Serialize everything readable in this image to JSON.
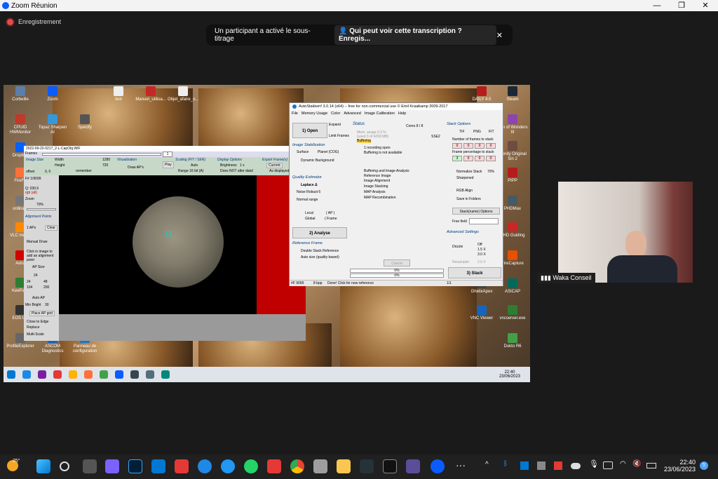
{
  "zoom": {
    "window_title": "Zoom Réunion",
    "recording_label": "Enregistrement",
    "caption_notice": "Un participant a activé le sous-titrage",
    "caption_question": "Qui peut voir cette transcription ? Enregis...",
    "participant_name": "Waka Conseil"
  },
  "colors": {
    "zoom_blue": "#0b5cff",
    "record_red": "#e54b4b",
    "as_red_canvas": "#c00000"
  },
  "desktop": {
    "icons_left": [
      {
        "label": "Corbeille",
        "color": "#5d7ea8"
      },
      {
        "label": "Zoom",
        "color": "#0b5cff"
      },
      {
        "label": "CPUID HWMonitor",
        "color": "#c0392b"
      },
      {
        "label": "Topaz Sharpen AI",
        "color": "#3498db"
      },
      {
        "label": "Specify",
        "color": "#555"
      },
      {
        "label": "Dropbox",
        "color": "#0061fe"
      },
      {
        "label": "FireFo",
        "color": "#ff7139"
      },
      {
        "label": "ordinate",
        "color": "#777"
      },
      {
        "label": "VLC media",
        "color": "#ff8800"
      },
      {
        "label": "Avira",
        "color": "#d20000"
      },
      {
        "label": "KeePass",
        "color": "#2e7d32"
      },
      {
        "label": "EOS Util",
        "color": "#333"
      },
      {
        "label": "ProfileExplorer",
        "color": "#666"
      },
      {
        "label": "ASCOM Diagnostics",
        "color": "#1565c0"
      },
      {
        "label": "Panneau de configuration",
        "color": "#1976d2"
      }
    ],
    "icons_top": [
      {
        "label": "test"
      },
      {
        "label": "Manuel_utilisa..."
      },
      {
        "label": "Objet_afaire_o..."
      },
      {
        "label": "DAILY 4.0"
      },
      {
        "label": "Steam"
      }
    ],
    "icons_right": [
      {
        "label": "Age of Wonders III",
        "color": "#8e44ad"
      },
      {
        "label": "Infinity Original Sin 2",
        "color": "#6d4c41"
      },
      {
        "label": "PIPP",
        "color": "#b71c1c"
      },
      {
        "label": "PHDMax",
        "color": "#455a64"
      },
      {
        "label": "PHD Guiding",
        "color": "#c62828"
      },
      {
        "label": "FireCapture",
        "color": "#e65100"
      },
      {
        "label": "GhelixApex",
        "color": "#424242"
      },
      {
        "label": "ASICAP",
        "color": "#00695c"
      },
      {
        "label": "VNC Viewer",
        "color": "#1565c0"
      },
      {
        "label": "vncserver.exe",
        "color": "#2e7d32"
      },
      {
        "label": "Dukto R6",
        "color": "#43a047"
      }
    ]
  },
  "autostakkert": {
    "title": "AutoStakkert! 3.0.14 (x64) -- free for non-commercial use © Emil Kraaikamp 2009-2017",
    "menu": [
      "File",
      "Memory Usage",
      "Color",
      "Advanced",
      "Image Calibration",
      "Help"
    ],
    "open_button": "1) Open",
    "expand": "Expand",
    "limit_frames": "Limit Frames",
    "status_heading": "Status",
    "cores": "Cores 8 / 8",
    "sse": "SSE2",
    "mem": "Mem. usage 0.3 %",
    "mem2": "(used 3 of 4299 MB)",
    "buffering": "Buffering",
    "status_lines": [
      "1 recording open",
      "Buffering is not available"
    ],
    "analysis_lines": [
      "Buffering and Image Analysis",
      "Reference Image",
      "Image Alignment",
      "Image Stacking",
      "MAP Analysis",
      "MAP Recombination"
    ],
    "image_stab_heading": "Image Stabilization",
    "surface": "Surface",
    "planet": "Planet (COG)",
    "dynamic_bg": "Dynamic Background",
    "quality_heading": "Quality Estimator",
    "laplace": "Laplace Δ",
    "noise_robust": "Noise Robust 6",
    "normal_range": "Normal range",
    "local": "Local",
    "local_ap": "( AP )",
    "global": "Global",
    "global_frame": "( Frame",
    "analyse_button": "2) Analyse",
    "ref_heading": "Reference Frame",
    "double_stack": "Double Stack Reference",
    "auto_size": "Auto size (quality based)",
    "cancel": "Cancel",
    "progress1": "0%",
    "progress2": "0%",
    "progress_value": 0,
    "statusbar_frames": "#F 9099",
    "statusbar_bpp": "8 bpp",
    "statusbar_msg": "Done! Click for new reference",
    "statusbar_page": "1/1",
    "stack_heading": "Stack Options",
    "fmt_tif": "TIF",
    "fmt_png": "PNG",
    "fmt_fit": "FIT",
    "num_frames": "Number of frames to stack",
    "frame_pct": "Frame percentage to stack",
    "num_inputs": [
      "0",
      "0",
      "0",
      "0"
    ],
    "pct_inputs": [
      "3",
      "0",
      "0",
      "0"
    ],
    "normalize": "Normalize Stack",
    "normalize_val": "70%",
    "sharpened": "Sharpened",
    "rgb_align": "RGB Align",
    "save_folders": "Save in Folders",
    "stackname_button": "Stack(name) Options",
    "free_field": "Free field",
    "advanced_heading": "Advanced Settings",
    "drizzle": "Drizzle",
    "drizzle_options": [
      "Off",
      "1.5 X",
      "3.0 X"
    ],
    "resampler": "Resampler",
    "resampler_opt": "2.0 X",
    "stack_button": "3) Stack"
  },
  "viewer": {
    "title": "2022-09-22-0217_2-L-CapObj.WIF",
    "frames_label": "Frames",
    "frame_value": "1",
    "image_size": "Image Size",
    "width_label": "Width",
    "width_val": "1280",
    "height_label": "Height",
    "height_val": "720",
    "remember": "remember",
    "offset": "offset",
    "offset_val": "0, 0",
    "visualization": "Visualization",
    "draw_aps": "Draw AP's",
    "play": "Play",
    "scaling": "Scaling (FIT / SER)",
    "auto": "Auto",
    "range": "Range 16 bit (A)",
    "display_options": "Display Options",
    "brightness": "Brightness",
    "brightness_val": "1 x",
    "not_alter": "Does NOT alter data!",
    "export_frame": "Export Frame(s)",
    "current": "Current",
    "as_displayed": "As displayed",
    "frame_num": "F# 1/9099",
    "quality": "Q: 030.6",
    "rgb": "rgb (all)",
    "zoom": "Zoom",
    "zoom_val": "70%",
    "alignment_points": "Alignment Points",
    "aps": "1 APs",
    "clear": "Clear",
    "manual_draw": "Manual Draw",
    "click_hint": "Click in image to add an alignment point",
    "ap_size": "AP Size",
    "ap_sizes": [
      "24",
      "48",
      "104",
      "200"
    ],
    "ap_size_val": "24",
    "auto_ap": "Auto AP",
    "min_bright": "Min Bright",
    "min_bright_val": "30",
    "place_grid": "Place AP grid",
    "close_edge": "Close to Edge",
    "replace": "Replace",
    "multi_scale": "Multi-Scale"
  },
  "inner_taskbar": {
    "time": "22:40",
    "date": "23/06/2023"
  },
  "taskbar": {
    "weather": "25°",
    "time": "22:40",
    "date": "23/06/2023",
    "notif_count": "5"
  }
}
